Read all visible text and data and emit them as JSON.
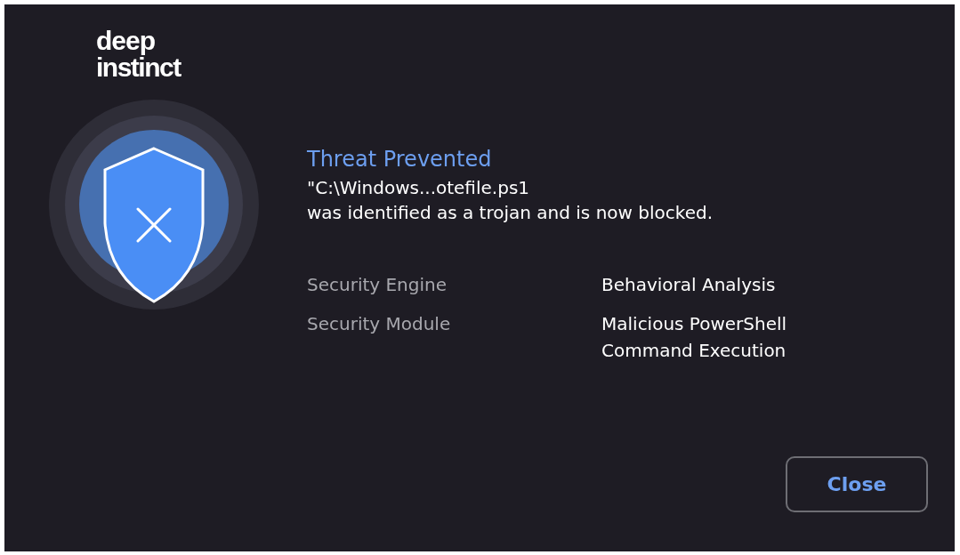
{
  "logo": {
    "line_1": "deep",
    "line_2": "instinct"
  },
  "alert": {
    "title": "Threat Prevented",
    "path": "\"C:\\Windows...otefile.ps1",
    "message": "was identified as a trojan and is now blocked."
  },
  "details": [
    {
      "label": "Security Engine",
      "value": "Behavioral Analysis"
    },
    {
      "label": "Security Module",
      "value": "Malicious PowerShell\nCommand Execution"
    }
  ],
  "buttons": [
    "Close"
  ]
}
